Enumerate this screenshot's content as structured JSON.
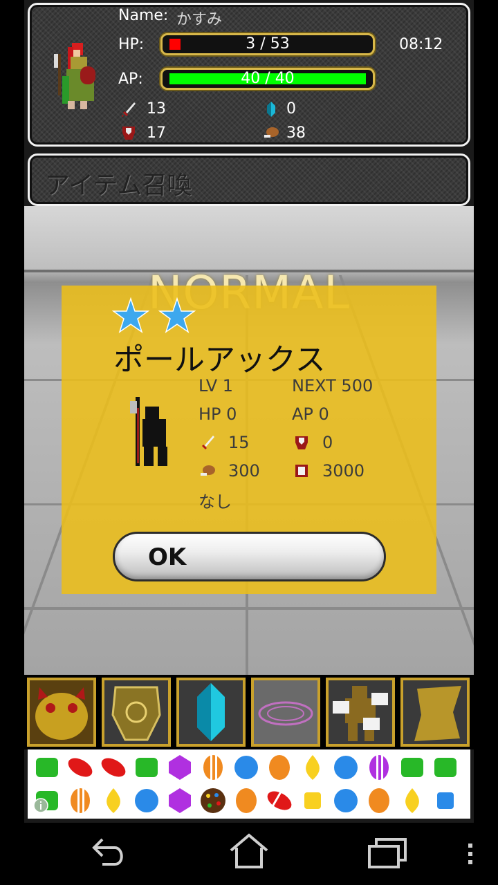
{
  "status": {
    "name_label": "Name:",
    "name_value": "かすみ",
    "hp_label": "HP:",
    "hp_text": "3 / 53",
    "hp_fraction": 0.057,
    "ap_label": "AP:",
    "ap_text": "40 / 40",
    "ap_fraction": 1.0,
    "time": "08:12",
    "attack": "13",
    "crystals": "0",
    "defense": "17",
    "food": "38"
  },
  "screen_title": "アイテム召喚",
  "result": {
    "rarity": "NORMAL",
    "stars": 2,
    "item_name": "ポールアックス",
    "lv": "LV 1",
    "next": "NEXT 500",
    "hp": "HP 0",
    "ap": "AP 0",
    "attack": "15",
    "defense": "0",
    "food_cost": "300",
    "sell": "3000",
    "skill": "なし",
    "ok_label": "OK"
  },
  "menu_icons": [
    "summon-beast-icon",
    "armor-icon",
    "crystal-icon",
    "magic-circle-icon",
    "golem-icon",
    "scroll-icon"
  ],
  "colors": {
    "hp_fill": "#ff0000",
    "ap_fill": "#00ff00",
    "card_bg": "#ecbe1a",
    "menu_border": "#c9a12c"
  }
}
